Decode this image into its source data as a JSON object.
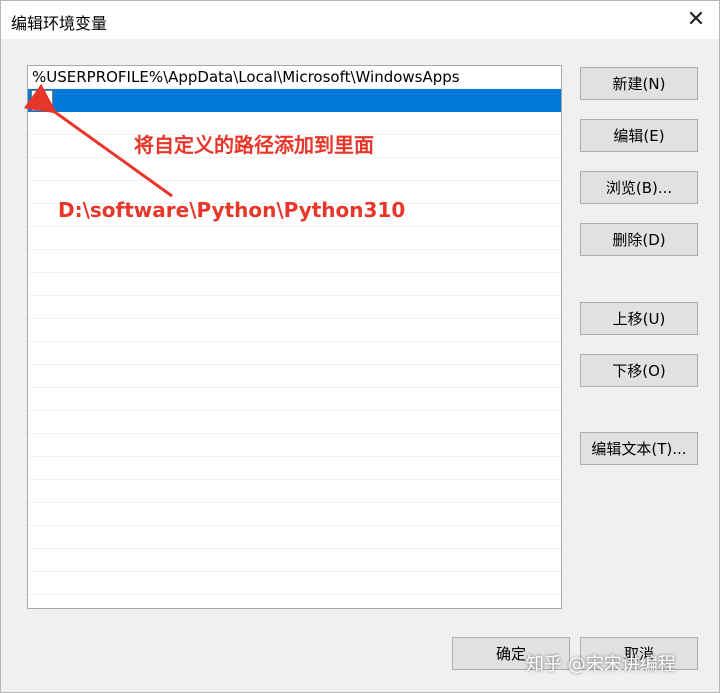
{
  "window": {
    "title": "编辑环境变量",
    "close_glyph": "✕"
  },
  "path_list": {
    "entries": [
      "%USERPROFILE%\\AppData\\Local\\Microsoft\\WindowsApps",
      ""
    ],
    "selected_index": 1,
    "empty_rows": 21
  },
  "buttons": {
    "new": "新建(N)",
    "edit": "编辑(E)",
    "browse": "浏览(B)...",
    "delete": "删除(D)",
    "move_up": "上移(U)",
    "move_down": "下移(O)",
    "edit_text": "编辑文本(T)...",
    "ok": "确定",
    "cancel": "取消"
  },
  "annotation": {
    "instruction": "将自定义的路径添加到里面",
    "path_example": "D:\\software\\Python\\Python310",
    "color": "#e8372a"
  },
  "watermark": "知乎 @宋宋讲编程",
  "colors": {
    "selection": "#0078d7",
    "button_face": "#e1e1e1"
  }
}
